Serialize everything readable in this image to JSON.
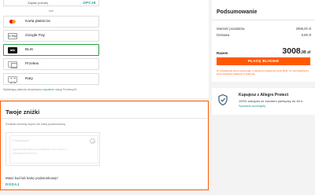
{
  "payment": {
    "later_label": "Zapłać później",
    "later_option": "OPCJE",
    "or_label": "lub",
    "methods": [
      {
        "label": "Karta płatnicza",
        "icon": "card-icon"
      },
      {
        "label": "Google Pay",
        "icon": "gpay-icon",
        "icon_text": "G Pay"
      },
      {
        "label": "BLIK",
        "icon": "blik-icon",
        "icon_text": "blik",
        "selected": true
      },
      {
        "label": "Przelew",
        "icon": "bank-transfer-icon"
      },
      {
        "label": "Raty",
        "icon": "installments-icon"
      }
    ],
    "note_prefix": "Wybierając płatność akceptujesz",
    "note_link": "regulamin",
    "note_suffix": "usługi Przelewy24."
  },
  "discounts": {
    "title": "Twoje zniżki",
    "subtitle": "Dodaniu dowolny kupon lub kartę podarunkową",
    "coupon_top": "0 dostępnych",
    "coupon_desc": "Wykorzystaj tekstowy przykładowy opis kuponu z niedostępnej kolumny",
    "gift_question": "Masz kod lub kartę podarunkową?",
    "add_link": "DODAJ"
  },
  "summary": {
    "title": "Podsumowanie",
    "products_label": "Wartość produktów",
    "products_value": "2999,00 zł",
    "delivery_label": "Dostawa",
    "delivery_value": "9,99 zł",
    "total_label": "Razem",
    "total_main": "3008",
    "total_cents": ",99 zł",
    "pay_button": "PŁACĘ BLIKIEM",
    "legal_note": "W rozwiązanie kroku wykonując z opiekuną ustawienie Kody BLIK. Po wprowadzeniu kodu potwierdź płatność w telefonie."
  },
  "protect": {
    "title": "Kupujesz z Allegro Protect",
    "text": "100% zakupów ze zwrotem pieniędzy do 48 h.",
    "link": "Sprawdź szczegóły",
    "shield_color": "#3b5b72"
  },
  "colors": {
    "accent": "#ff5a00",
    "link": "#1a9a8f",
    "selected": "#25a244"
  }
}
